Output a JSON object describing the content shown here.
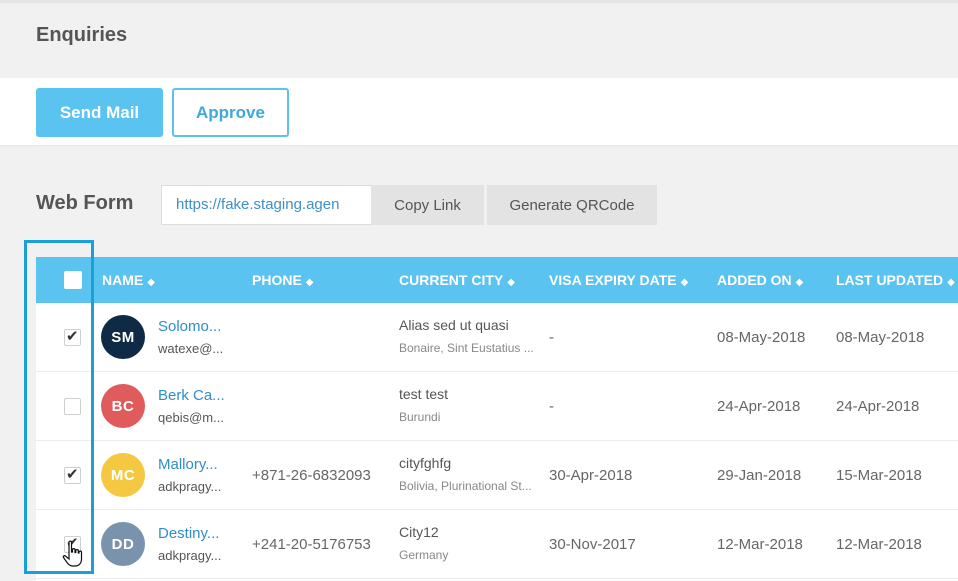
{
  "page_title": "Enquiries",
  "actions": {
    "send_mail": "Send Mail",
    "approve": "Approve"
  },
  "web_form": {
    "label": "Web Form",
    "link_value": "https://fake.staging.agen",
    "copy_link": "Copy Link",
    "generate_qr": "Generate QRCode"
  },
  "table": {
    "columns": [
      "NAME",
      "PHONE",
      "CURRENT CITY",
      "VISA EXPIRY DATE",
      "ADDED ON",
      "LAST UPDATED"
    ],
    "sort_icon": "sort-icon",
    "rows": [
      {
        "checked": true,
        "initials": "SM",
        "avatar_color": "#0f2a44",
        "name": "Solomo...",
        "email": "watexe@...",
        "phone": "",
        "city": "Alias sed ut quasi",
        "country": "Bonaire, Sint Eustatius ...",
        "visa_expiry": "-",
        "added_on": "08-May-2018",
        "last_updated": "08-May-2018"
      },
      {
        "checked": false,
        "initials": "BC",
        "avatar_color": "#e05c5c",
        "name": "Berk Ca...",
        "email": "qebis@m...",
        "phone": "",
        "city": "test test",
        "country": "Burundi",
        "visa_expiry": "-",
        "added_on": "24-Apr-2018",
        "last_updated": "24-Apr-2018"
      },
      {
        "checked": true,
        "initials": "MC",
        "avatar_color": "#f5c842",
        "name": "Mallory...",
        "email": "adkpragy...",
        "phone": "+871-26-6832093",
        "city": "cityfghfg",
        "country": "Bolivia, Plurinational St...",
        "visa_expiry": "30-Apr-2018",
        "added_on": "29-Jan-2018",
        "last_updated": "15-Mar-2018"
      },
      {
        "checked": true,
        "initials": "DD",
        "avatar_color": "#7a93ad",
        "name": "Destiny...",
        "email": "adkpragy...",
        "phone": "+241-20-5176753",
        "city": "City12",
        "country": "Germany",
        "visa_expiry": "30-Nov-2017",
        "added_on": "12-Mar-2018",
        "last_updated": "12-Mar-2018"
      }
    ]
  },
  "colors": {
    "accent": "#5ac3f0",
    "highlight": "#1a9fd6",
    "link": "#2e8ecb"
  }
}
